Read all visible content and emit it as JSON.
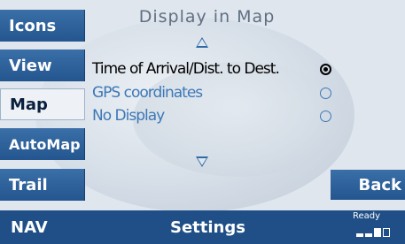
{
  "sidebar": {
    "items": [
      {
        "label": "Icons"
      },
      {
        "label": "View"
      },
      {
        "label": "Map"
      },
      {
        "label": "AutoMap"
      },
      {
        "label": "Trail"
      }
    ]
  },
  "header": {
    "title": "Display in Map"
  },
  "options": [
    {
      "label": "Time of Arrival/Dist. to Dest.",
      "selected": true
    },
    {
      "label": "GPS coordinates",
      "selected": false
    },
    {
      "label": "No Display",
      "selected": false
    }
  ],
  "back_label": "Back",
  "bottom": {
    "left_label": "NAV",
    "center_label": "Settings",
    "status_label": "Ready"
  },
  "signal": {
    "level": 3,
    "max": 4
  },
  "colors": {
    "accent": "#2e6aa6",
    "bar": "#1f4f86",
    "selected_text": "#000000",
    "unselected_text": "#3d78b6"
  }
}
